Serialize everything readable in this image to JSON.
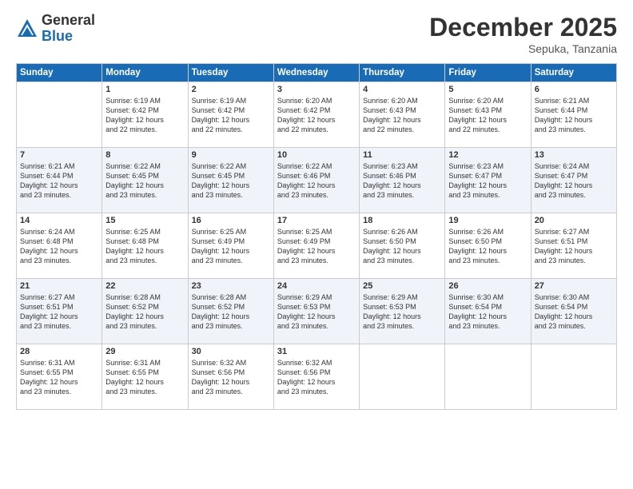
{
  "logo": {
    "general": "General",
    "blue": "Blue"
  },
  "header": {
    "month": "December 2025",
    "location": "Sepuka, Tanzania"
  },
  "weekdays": [
    "Sunday",
    "Monday",
    "Tuesday",
    "Wednesday",
    "Thursday",
    "Friday",
    "Saturday"
  ],
  "weeks": [
    [
      {
        "day": "",
        "info": ""
      },
      {
        "day": "1",
        "info": "Sunrise: 6:19 AM\nSunset: 6:42 PM\nDaylight: 12 hours\nand 22 minutes."
      },
      {
        "day": "2",
        "info": "Sunrise: 6:19 AM\nSunset: 6:42 PM\nDaylight: 12 hours\nand 22 minutes."
      },
      {
        "day": "3",
        "info": "Sunrise: 6:20 AM\nSunset: 6:42 PM\nDaylight: 12 hours\nand 22 minutes."
      },
      {
        "day": "4",
        "info": "Sunrise: 6:20 AM\nSunset: 6:43 PM\nDaylight: 12 hours\nand 22 minutes."
      },
      {
        "day": "5",
        "info": "Sunrise: 6:20 AM\nSunset: 6:43 PM\nDaylight: 12 hours\nand 22 minutes."
      },
      {
        "day": "6",
        "info": "Sunrise: 6:21 AM\nSunset: 6:44 PM\nDaylight: 12 hours\nand 23 minutes."
      }
    ],
    [
      {
        "day": "7",
        "info": "Sunrise: 6:21 AM\nSunset: 6:44 PM\nDaylight: 12 hours\nand 23 minutes."
      },
      {
        "day": "8",
        "info": "Sunrise: 6:22 AM\nSunset: 6:45 PM\nDaylight: 12 hours\nand 23 minutes."
      },
      {
        "day": "9",
        "info": "Sunrise: 6:22 AM\nSunset: 6:45 PM\nDaylight: 12 hours\nand 23 minutes."
      },
      {
        "day": "10",
        "info": "Sunrise: 6:22 AM\nSunset: 6:46 PM\nDaylight: 12 hours\nand 23 minutes."
      },
      {
        "day": "11",
        "info": "Sunrise: 6:23 AM\nSunset: 6:46 PM\nDaylight: 12 hours\nand 23 minutes."
      },
      {
        "day": "12",
        "info": "Sunrise: 6:23 AM\nSunset: 6:47 PM\nDaylight: 12 hours\nand 23 minutes."
      },
      {
        "day": "13",
        "info": "Sunrise: 6:24 AM\nSunset: 6:47 PM\nDaylight: 12 hours\nand 23 minutes."
      }
    ],
    [
      {
        "day": "14",
        "info": "Sunrise: 6:24 AM\nSunset: 6:48 PM\nDaylight: 12 hours\nand 23 minutes."
      },
      {
        "day": "15",
        "info": "Sunrise: 6:25 AM\nSunset: 6:48 PM\nDaylight: 12 hours\nand 23 minutes."
      },
      {
        "day": "16",
        "info": "Sunrise: 6:25 AM\nSunset: 6:49 PM\nDaylight: 12 hours\nand 23 minutes."
      },
      {
        "day": "17",
        "info": "Sunrise: 6:25 AM\nSunset: 6:49 PM\nDaylight: 12 hours\nand 23 minutes."
      },
      {
        "day": "18",
        "info": "Sunrise: 6:26 AM\nSunset: 6:50 PM\nDaylight: 12 hours\nand 23 minutes."
      },
      {
        "day": "19",
        "info": "Sunrise: 6:26 AM\nSunset: 6:50 PM\nDaylight: 12 hours\nand 23 minutes."
      },
      {
        "day": "20",
        "info": "Sunrise: 6:27 AM\nSunset: 6:51 PM\nDaylight: 12 hours\nand 23 minutes."
      }
    ],
    [
      {
        "day": "21",
        "info": "Sunrise: 6:27 AM\nSunset: 6:51 PM\nDaylight: 12 hours\nand 23 minutes."
      },
      {
        "day": "22",
        "info": "Sunrise: 6:28 AM\nSunset: 6:52 PM\nDaylight: 12 hours\nand 23 minutes."
      },
      {
        "day": "23",
        "info": "Sunrise: 6:28 AM\nSunset: 6:52 PM\nDaylight: 12 hours\nand 23 minutes."
      },
      {
        "day": "24",
        "info": "Sunrise: 6:29 AM\nSunset: 6:53 PM\nDaylight: 12 hours\nand 23 minutes."
      },
      {
        "day": "25",
        "info": "Sunrise: 6:29 AM\nSunset: 6:53 PM\nDaylight: 12 hours\nand 23 minutes."
      },
      {
        "day": "26",
        "info": "Sunrise: 6:30 AM\nSunset: 6:54 PM\nDaylight: 12 hours\nand 23 minutes."
      },
      {
        "day": "27",
        "info": "Sunrise: 6:30 AM\nSunset: 6:54 PM\nDaylight: 12 hours\nand 23 minutes."
      }
    ],
    [
      {
        "day": "28",
        "info": "Sunrise: 6:31 AM\nSunset: 6:55 PM\nDaylight: 12 hours\nand 23 minutes."
      },
      {
        "day": "29",
        "info": "Sunrise: 6:31 AM\nSunset: 6:55 PM\nDaylight: 12 hours\nand 23 minutes."
      },
      {
        "day": "30",
        "info": "Sunrise: 6:32 AM\nSunset: 6:56 PM\nDaylight: 12 hours\nand 23 minutes."
      },
      {
        "day": "31",
        "info": "Sunrise: 6:32 AM\nSunset: 6:56 PM\nDaylight: 12 hours\nand 23 minutes."
      },
      {
        "day": "",
        "info": ""
      },
      {
        "day": "",
        "info": ""
      },
      {
        "day": "",
        "info": ""
      }
    ]
  ]
}
